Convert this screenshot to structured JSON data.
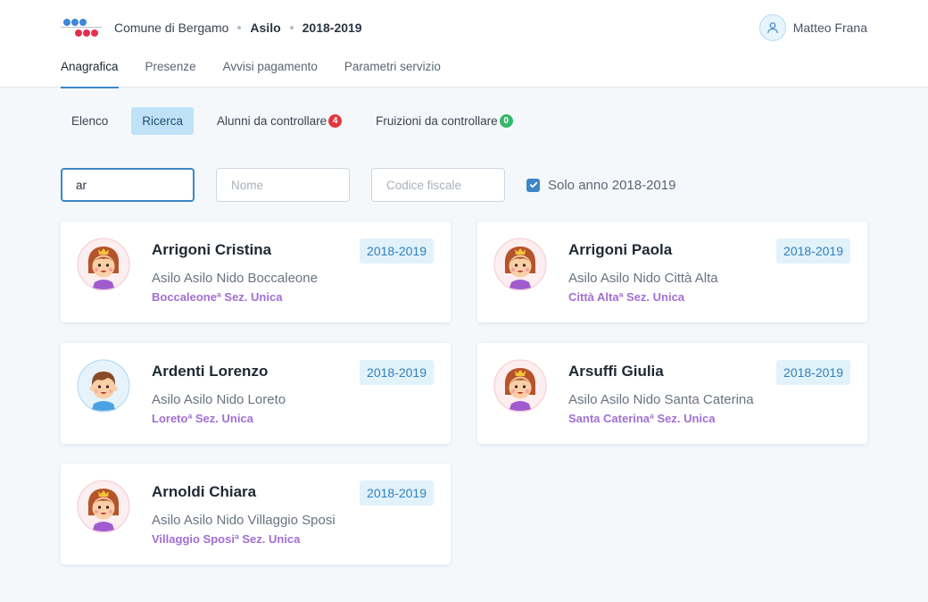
{
  "header": {
    "breadcrumb": [
      "Comune di Bergamo",
      "Asilo",
      "2018-2019"
    ],
    "user_name": "Matteo Frana",
    "tabs": [
      "Anagrafica",
      "Presenze",
      "Avvisi pagamento",
      "Parametri servizio"
    ]
  },
  "subnav": {
    "tabs": [
      {
        "label": "Elenco"
      },
      {
        "label": "Ricerca"
      },
      {
        "label": "Alunni da controllare",
        "badge": "4",
        "badge_color": "#e0393e"
      },
      {
        "label": "Fruizioni da controllare",
        "badge": "0",
        "badge_color": "#35b66b"
      }
    ]
  },
  "filters": {
    "search_value": "ar",
    "nome_placeholder": "Nome",
    "cf_placeholder": "Codice fiscale",
    "checkbox_label": "Solo anno 2018-2019"
  },
  "students": [
    {
      "name": "Arrigoni Cristina",
      "year": "2018-2019",
      "school": "Asilo Asilo Nido Boccaleone",
      "section": "Boccaleoneª Sez. Unica",
      "avatar": "girl"
    },
    {
      "name": "Arrigoni Paola",
      "year": "2018-2019",
      "school": "Asilo Asilo Nido Città Alta",
      "section": "Città Altaª Sez. Unica",
      "avatar": "girl"
    },
    {
      "name": "Ardenti Lorenzo",
      "year": "2018-2019",
      "school": "Asilo Asilo Nido Loreto",
      "section": "Loretoª Sez. Unica",
      "avatar": "boy"
    },
    {
      "name": "Arsuffi Giulia",
      "year": "2018-2019",
      "school": "Asilo Asilo Nido Santa Caterina",
      "section": "Santa Caterinaª Sez. Unica",
      "avatar": "girl"
    },
    {
      "name": "Arnoldi Chiara",
      "year": "2018-2019",
      "school": "Asilo Asilo Nido Villaggio Sposi",
      "section": "Villaggio Sposiª Sez. Unica",
      "avatar": "girl"
    }
  ],
  "colors": {
    "accent": "#3d86c8",
    "section_text": "#a26fd2",
    "background": "#f5f8fb"
  }
}
